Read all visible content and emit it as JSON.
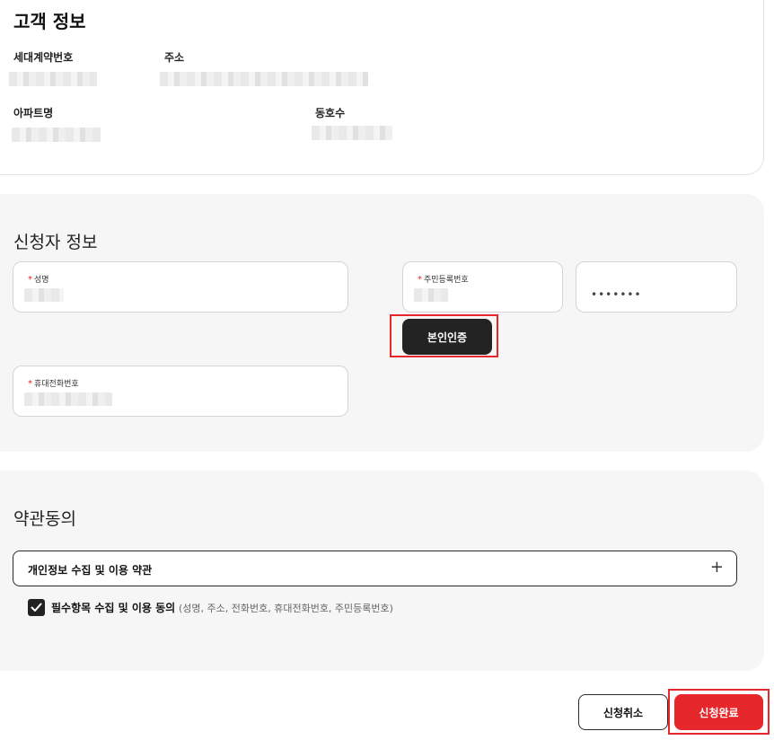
{
  "customer": {
    "title": "고객 정보",
    "fields": {
      "contract_no": {
        "label": "세대계약번호"
      },
      "address": {
        "label": "주소"
      },
      "apartment": {
        "label": "아파트명"
      },
      "unit_no": {
        "label": "동호수"
      }
    }
  },
  "applicant": {
    "title": "신청자 정보",
    "name": {
      "label": "성명"
    },
    "resident_no": {
      "label": "주민등록번호",
      "back_mask": "•••••••"
    },
    "verify_button": "본인인증",
    "mobile": {
      "label": "휴대전화번호"
    },
    "required_mark": "*"
  },
  "terms": {
    "title": "약관동의",
    "privacy_row": {
      "label": "개인정보 수집 및 이용 약관",
      "toggle_icon": "plus-icon",
      "toggle_glyph": "+"
    },
    "consent": {
      "checked": true,
      "label": "필수항목 수집 및 이용 동의",
      "detail": "(성명, 주소, 전화번호, 휴대전화번호, 주민등록번호)"
    }
  },
  "actions": {
    "cancel": "신청취소",
    "complete": "신청완료"
  },
  "colors": {
    "accent_red": "#e6272b",
    "dark_button": "#232323",
    "section_bg": "#f6f6f6"
  }
}
